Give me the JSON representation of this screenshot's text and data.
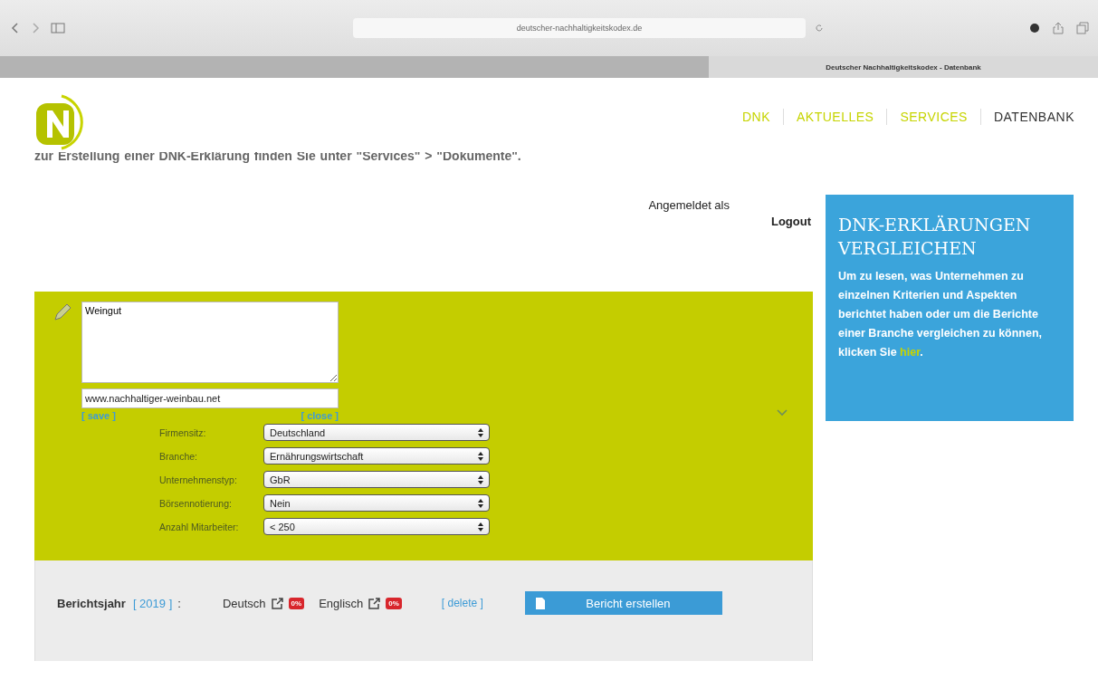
{
  "browser": {
    "url": "deutscher-nachhaltigkeitskodex.de",
    "tab_title": "Deutscher Nachhaltigkeitskodex - Datenbank"
  },
  "nav": [
    {
      "label": "DNK",
      "selected": false
    },
    {
      "label": "AKTUELLES",
      "selected": false
    },
    {
      "label": "SERVICES",
      "selected": false
    },
    {
      "label": "DATENBANK",
      "selected": true
    }
  ],
  "intro_text": "zur Erstellung einer DNK-Erklärung finden Sie unter \"Services\" > \"Dokumente\".",
  "login": {
    "label": "Angemeldet als",
    "logout": "Logout"
  },
  "company": {
    "name": "Weingut",
    "website": "www.nachhaltiger-weinbau.net",
    "save": "[ save ]",
    "close": "[ close ]",
    "fields": [
      {
        "label": "Firmensitz:",
        "value": "Deutschland"
      },
      {
        "label": "Branche:",
        "value": "Ernährungswirtschaft"
      },
      {
        "label": "Unternehmenstyp:",
        "value": "GbR"
      },
      {
        "label": "Börsennotierung:",
        "value": "Nein"
      },
      {
        "label": "Anzahl Mitarbeiter:",
        "value": "< 250"
      }
    ]
  },
  "report": {
    "label": "Berichtsjahr",
    "year": "[ 2019 ]",
    "colon": ":",
    "languages": [
      {
        "name": "Deutsch",
        "badge": "0%"
      },
      {
        "name": "Englisch",
        "badge": "0%"
      }
    ],
    "delete": "[ delete ]",
    "button": "Bericht erstellen"
  },
  "compare_box": {
    "title": "DNK-ERKLÄRUNGEN VERGLEICHEN",
    "text": "Um zu lesen, was Unternehmen zu einzelnen Kriterien und Aspekten berichtet haben oder um die Berichte einer Branche vergleichen zu können, klicken Sie",
    "link": "hier",
    "end": "."
  }
}
